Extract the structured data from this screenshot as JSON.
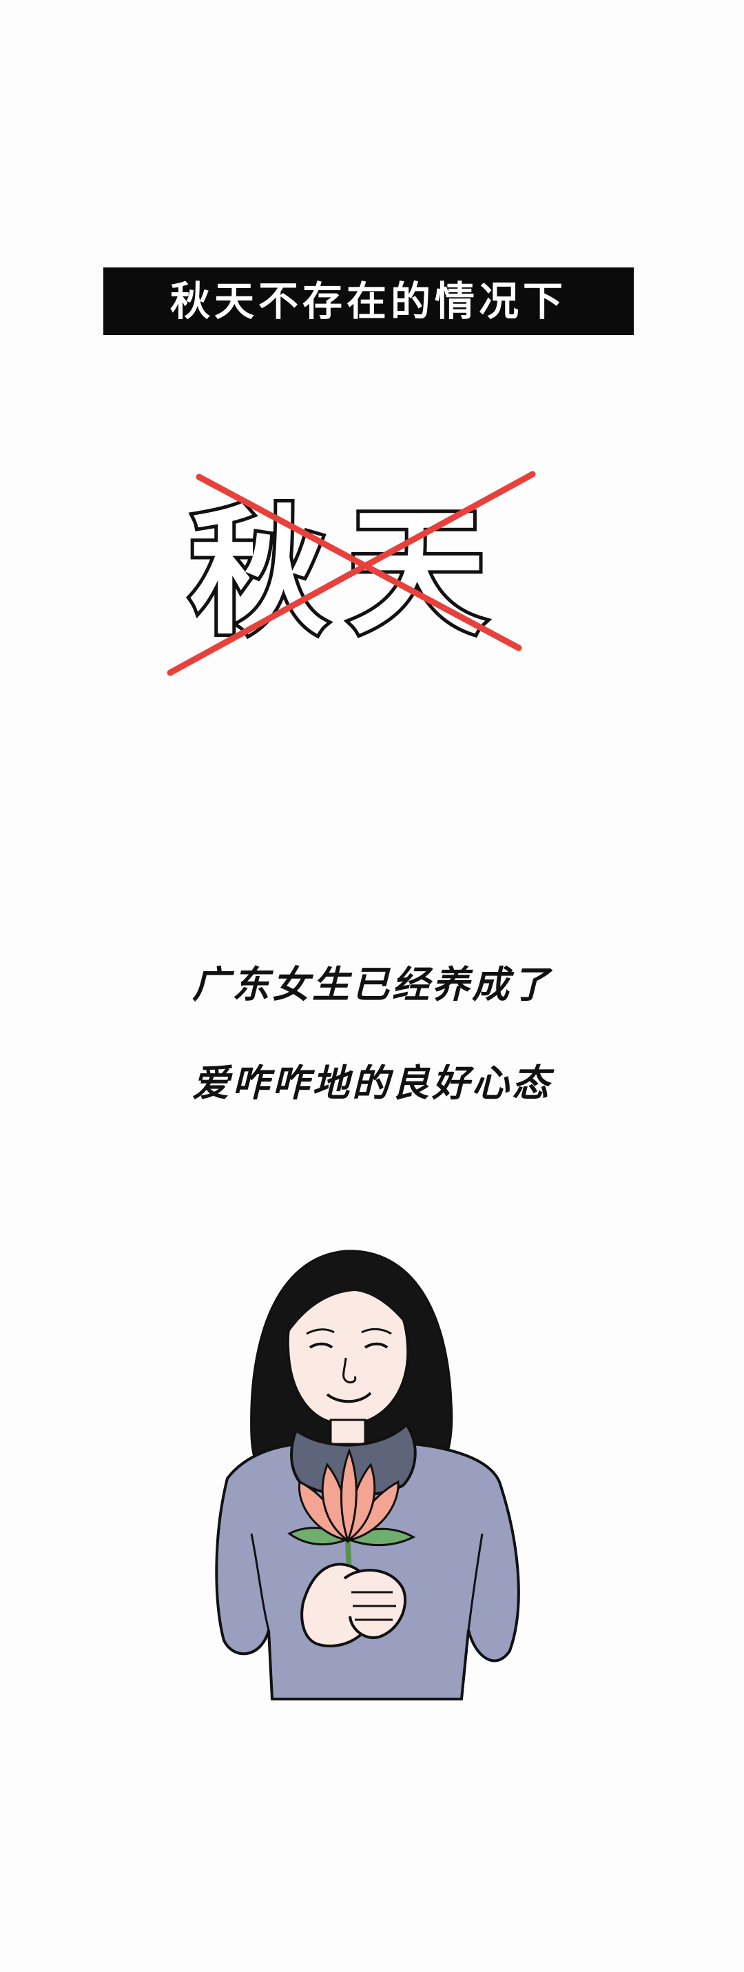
{
  "title_bar": {
    "text": "秋天不存在的情况下"
  },
  "crossed_word": {
    "text": "秋天",
    "strike_color": "#e8413c"
  },
  "captions": {
    "line1": "广东女生已经养成了",
    "line2": "爱咋咋地的良好心态"
  },
  "illustration": {
    "subject": "woman-holding-lotus",
    "colors": {
      "hair": "#141414",
      "skin": "#fbe9e3",
      "scarf": "#5e6479",
      "sweater": "#9a9fc0",
      "lotus": "#f4a493",
      "leaf": "#6fae6d"
    }
  }
}
